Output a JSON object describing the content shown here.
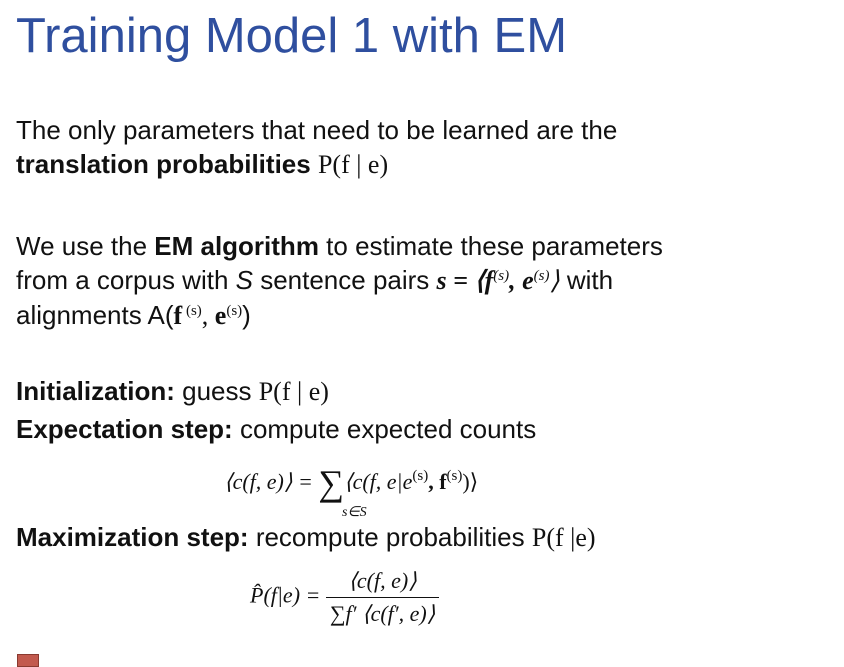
{
  "title": "Training Model 1 with EM",
  "p1": {
    "line1": "The only parameters that need to be learned are the",
    "bold": "translation probabilities",
    "expr": "P(f | e)"
  },
  "p2": {
    "pre": "We use the ",
    "bold": "EM algorithm",
    "post1": " to estimate these parameters",
    "line2a": "from a corpus with ",
    "S": "S",
    "line2b": " sentence pairs ",
    "pair": "s = ⟨f",
    "pair_sup1": "(s)",
    "pair_mid": ", e",
    "pair_sup2": "(s)",
    "pair_end": "⟩",
    "line2c": " with",
    "line3a": "alignments A(",
    "f": "f",
    "sup1": " (s)",
    "comma": ", ",
    "e": "e",
    "sup2": "(s)",
    "close": ")"
  },
  "init": {
    "label": "Initialization:",
    "text": " guess ",
    "expr": "P(f | e)"
  },
  "estep": {
    "label": "Expectation step:",
    "text": " compute expected counts"
  },
  "eq1": {
    "lhs": "⟨c(f, e)⟩ = ",
    "sum": "∑",
    "rhs": "⟨c(f, e|e",
    "sup1": "(s)",
    "mid": ", f",
    "sup2": "(s)",
    "end": ")⟩",
    "under": "s∈S"
  },
  "mstep": {
    "label": "Maximization step:",
    "text": " recompute probabilities ",
    "expr": "P(f |e)"
  },
  "eq2": {
    "lhs": "P̂(f|e) = ",
    "num": "⟨c(f, e)⟩",
    "den": "∑f′ ⟨c(f′, e)⟩"
  }
}
